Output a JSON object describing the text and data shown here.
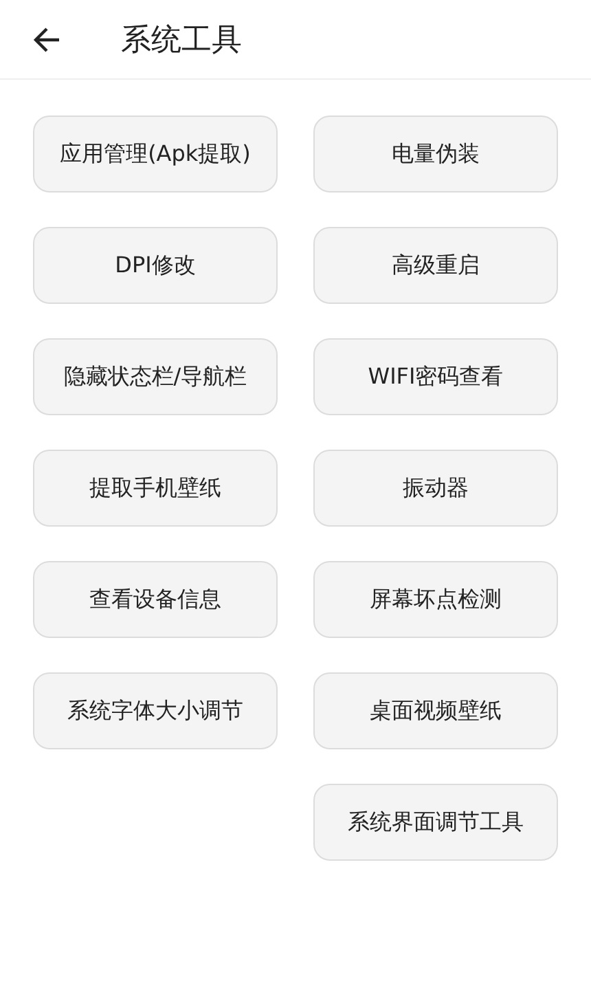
{
  "header": {
    "title": "系统工具"
  },
  "left_column": [
    {
      "label": "应用管理(Apk提取)"
    },
    {
      "label": "DPI修改"
    },
    {
      "label": "隐藏状态栏/导航栏"
    },
    {
      "label": "提取手机壁纸"
    },
    {
      "label": "查看设备信息"
    },
    {
      "label": "系统字体大小调节"
    }
  ],
  "right_column": [
    {
      "label": "电量伪装"
    },
    {
      "label": "高级重启"
    },
    {
      "label": "WIFI密码查看"
    },
    {
      "label": "振动器"
    },
    {
      "label": "屏幕坏点检测"
    },
    {
      "label": "桌面视频壁纸"
    },
    {
      "label": "系统界面调节工具"
    }
  ]
}
